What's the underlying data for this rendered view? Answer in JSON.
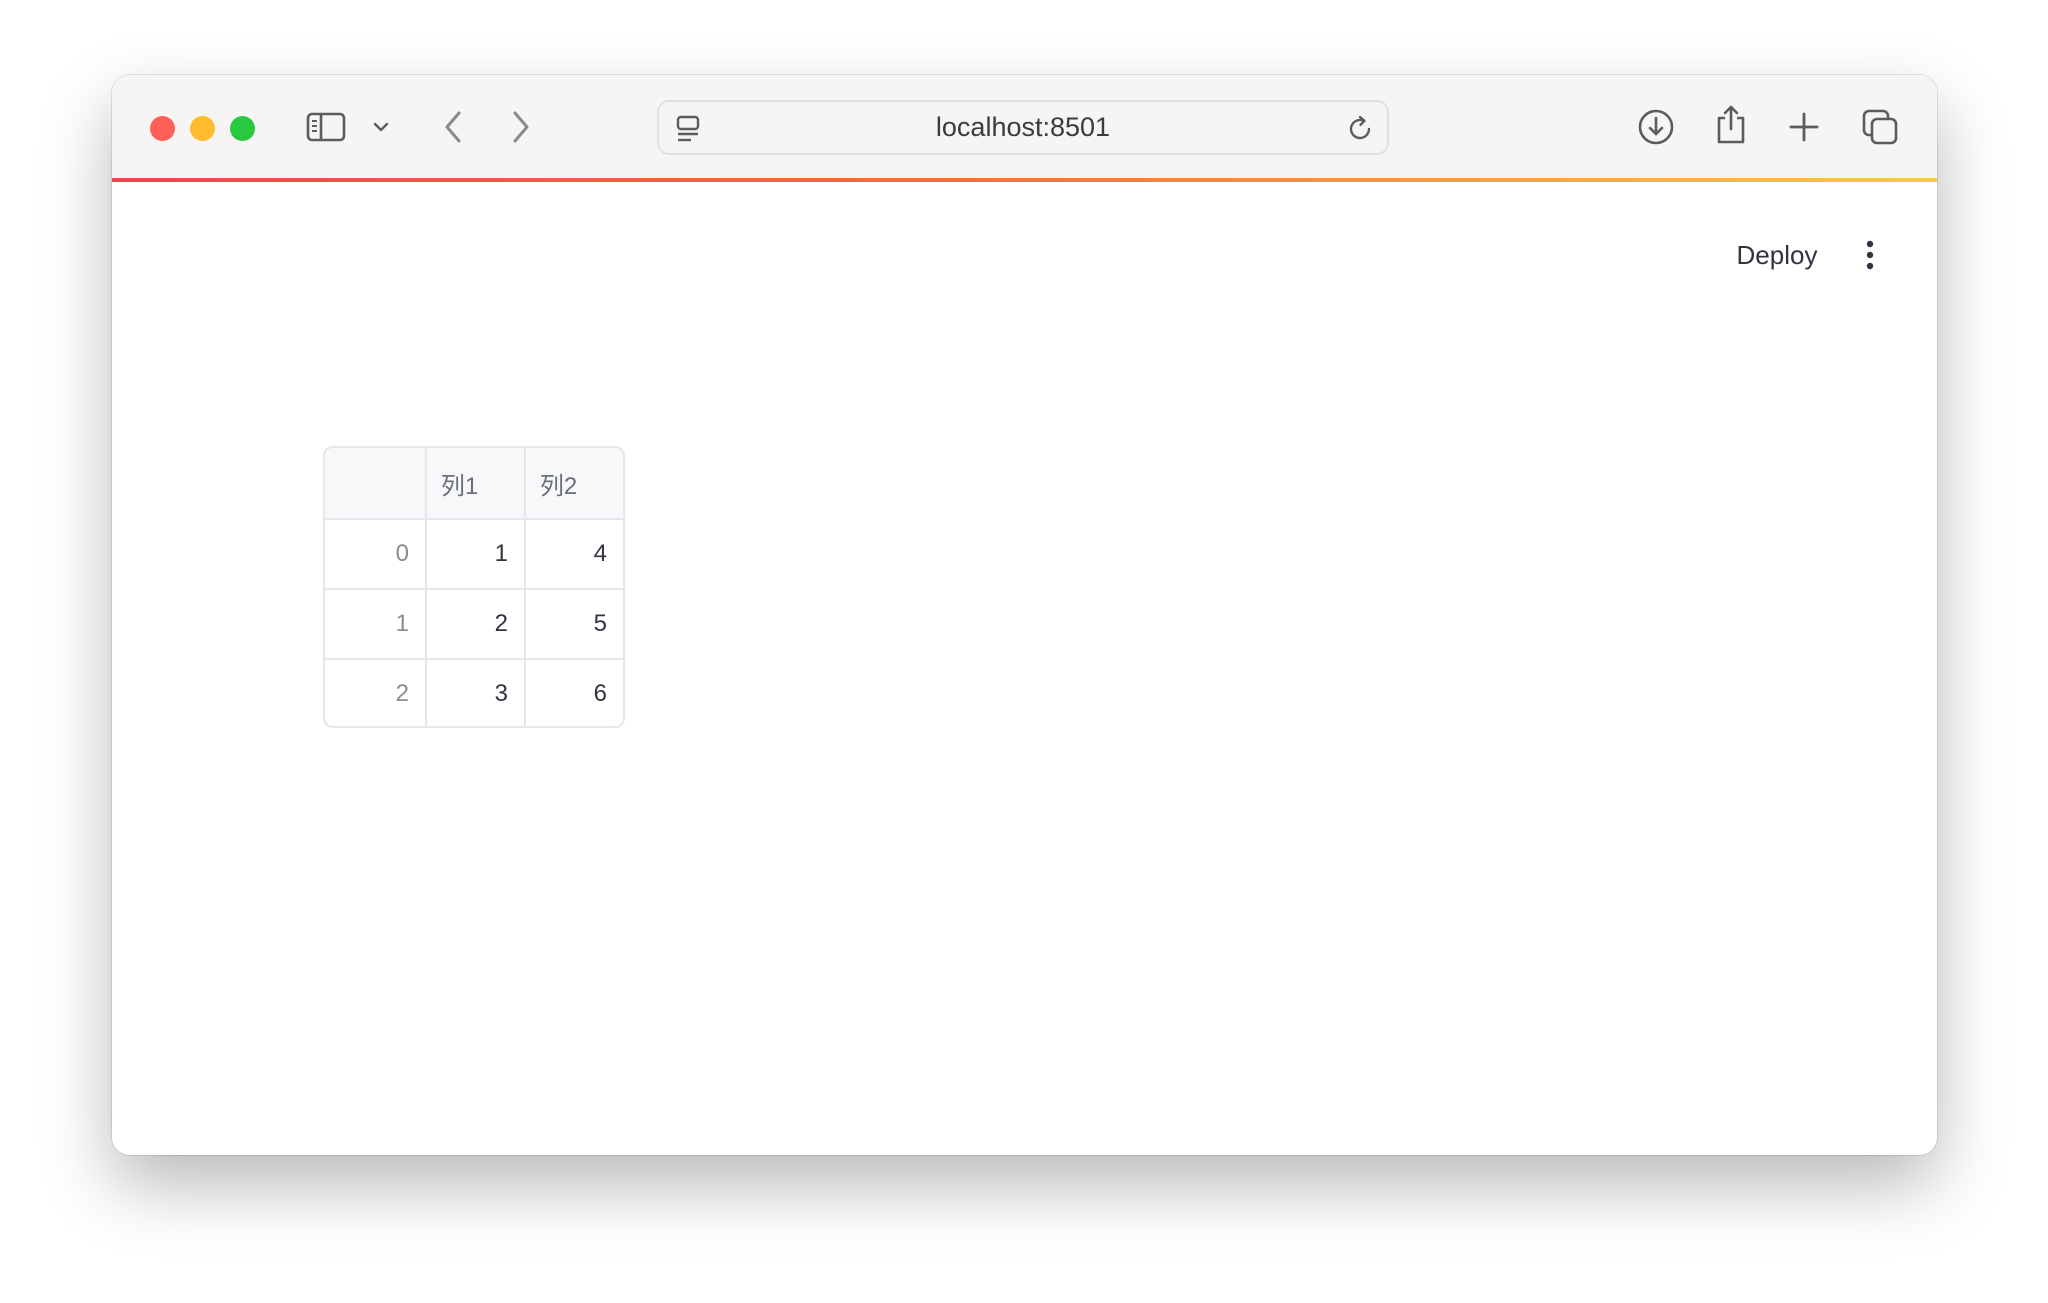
{
  "browser": {
    "url": "localhost:8501",
    "icons": {
      "sidebar": "sidebar-toggle-icon",
      "chevron": "chevron-down-icon",
      "back": "back-arrow-icon",
      "forward": "forward-arrow-icon",
      "site": "site-settings-icon",
      "reload": "reload-icon",
      "download": "download-icon",
      "share": "share-icon",
      "new_tab": "plus-icon",
      "tabs": "tabs-overview-icon"
    }
  },
  "colors": {
    "accent_start": "#f0444f",
    "accent_end": "#f7c948",
    "close": "#fe5f57",
    "minimize": "#febc2e",
    "zoom": "#28c840"
  },
  "app": {
    "deploy_label": "Deploy",
    "menu_icon": "kebab-menu-icon"
  },
  "table": {
    "columns": [
      "",
      "列1",
      "列2"
    ],
    "rows": [
      {
        "index": "0",
        "col1": "1",
        "col2": "4"
      },
      {
        "index": "1",
        "col1": "2",
        "col2": "5"
      },
      {
        "index": "2",
        "col1": "3",
        "col2": "6"
      }
    ]
  }
}
